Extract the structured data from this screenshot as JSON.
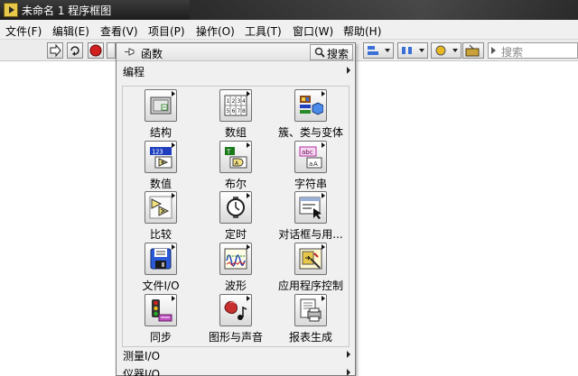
{
  "window": {
    "title": "未命名 1 程序框图"
  },
  "menu": [
    "文件(F)",
    "编辑(E)",
    "查看(V)",
    "项目(P)",
    "操作(O)",
    "工具(T)",
    "窗口(W)",
    "帮助(H)"
  ],
  "toolbar": {
    "search_placeholder": "搜索"
  },
  "palette": {
    "title": "函数",
    "search_label": "搜索",
    "top_category": "编程",
    "icons": [
      {
        "label": "结构",
        "icon": "structures-icon"
      },
      {
        "label": "数组",
        "icon": "array-icon"
      },
      {
        "label": "簇、类与变体",
        "icon": "cluster-class-variant-icon"
      },
      {
        "label": "数值",
        "icon": "numeric-icon"
      },
      {
        "label": "布尔",
        "icon": "boolean-icon"
      },
      {
        "label": "字符串",
        "icon": "string-icon"
      },
      {
        "label": "比较",
        "icon": "comparison-icon"
      },
      {
        "label": "定时",
        "icon": "timing-icon"
      },
      {
        "label": "对话框与用...",
        "icon": "dialog-user-interface-icon"
      },
      {
        "label": "文件I/O",
        "icon": "file-io-icon"
      },
      {
        "label": "波形",
        "icon": "waveform-icon"
      },
      {
        "label": "应用程序控制",
        "icon": "application-control-icon"
      },
      {
        "label": "同步",
        "icon": "synchronization-icon"
      },
      {
        "label": "图形与声音",
        "icon": "graphics-sound-icon"
      },
      {
        "label": "报表生成",
        "icon": "report-generation-icon"
      }
    ],
    "bottom_categories": [
      "测量I/O",
      "仪器I/O"
    ]
  },
  "colors": {
    "titlebar": "#1d1d1d",
    "palette_bg": "#f0f0f0",
    "accent_blue": "#1f3fbf"
  }
}
